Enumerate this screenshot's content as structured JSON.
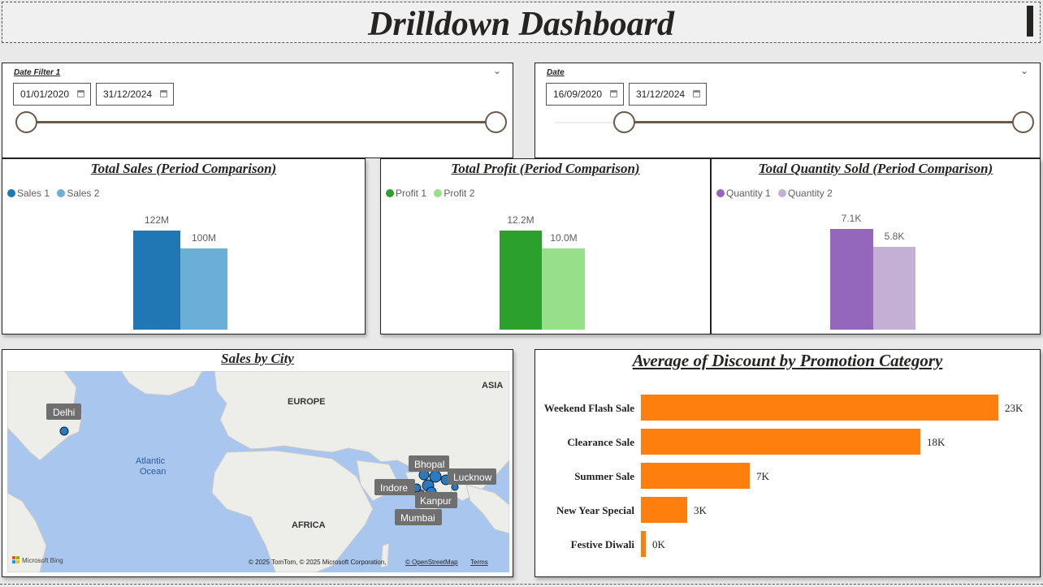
{
  "title": "Drilldown Dashboard",
  "slicer1": {
    "label": "Date Filter 1",
    "start": "01/01/2020",
    "end": "31/12/2024",
    "icon": "chevron-down-icon"
  },
  "slicer2": {
    "label": "Date",
    "start": "16/09/2020",
    "end": "31/12/2024",
    "icon": "chevron-down-icon"
  },
  "sales_chart": {
    "title": "Total Sales (Period Comparison)",
    "legend": [
      "Sales 1",
      "Sales 2"
    ],
    "colors": [
      "#1f77b4",
      "#6baed6"
    ],
    "labels": [
      "122M",
      "100M"
    ]
  },
  "profit_chart": {
    "title": "Total Profit (Period Comparison)",
    "legend": [
      "Profit 1",
      "Profit 2"
    ],
    "colors": [
      "#2ca02c",
      "#98df8a"
    ],
    "labels": [
      "12.2M",
      "10.0M"
    ]
  },
  "quantity_chart": {
    "title": "Total Quantity Sold (Period Comparison)",
    "legend": [
      "Quantity 1",
      "Quantity 2"
    ],
    "colors": [
      "#9467bd",
      "#c5b0d5"
    ],
    "labels": [
      "7.1K",
      "5.8K"
    ]
  },
  "map": {
    "title": "Sales by City",
    "regions": [
      "EUROPE",
      "ASIA",
      "AFRICA"
    ],
    "ocean": [
      "Atlantic",
      "Ocean"
    ],
    "cities": [
      "Delhi",
      "Bhopal",
      "Lucknow",
      "Indore",
      "Kanpur",
      "Mumbai"
    ],
    "attribution": "© 2025 TomTom, © 2025 Microsoft Corporation,",
    "osm": "© OpenStreetMap",
    "terms": "Terms",
    "bing": "Microsoft Bing"
  },
  "discount_chart": {
    "title": "Average of Discount by Promotion Category",
    "color": "#ff7f0e",
    "labels": [
      "23K",
      "18K",
      "7K",
      "3K",
      "0K"
    ]
  },
  "chart_data": [
    {
      "type": "bar",
      "title": "Total Sales (Period Comparison)",
      "series": [
        {
          "name": "Sales 1",
          "values": [
            122
          ]
        },
        {
          "name": "Sales 2",
          "values": [
            100
          ]
        }
      ],
      "unit": "M",
      "ylim": [
        0,
        122
      ]
    },
    {
      "type": "bar",
      "title": "Total Profit (Period Comparison)",
      "series": [
        {
          "name": "Profit 1",
          "values": [
            12.2
          ]
        },
        {
          "name": "Profit 2",
          "values": [
            10.0
          ]
        }
      ],
      "unit": "M",
      "ylim": [
        0,
        12.2
      ]
    },
    {
      "type": "bar",
      "title": "Total Quantity Sold (Period Comparison)",
      "series": [
        {
          "name": "Quantity 1",
          "values": [
            7.1
          ]
        },
        {
          "name": "Quantity 2",
          "values": [
            5.8
          ]
        }
      ],
      "unit": "K",
      "ylim": [
        0,
        7.1
      ]
    },
    {
      "type": "bar",
      "orientation": "horizontal",
      "title": "Average of Discount by Promotion Category",
      "categories": [
        "Weekend Flash Sale",
        "Clearance Sale",
        "Summer Sale",
        "New Year Special",
        "Festive Diwali"
      ],
      "values": [
        23,
        18,
        7,
        3,
        0.3
      ],
      "unit": "K",
      "xlim": [
        0,
        23
      ]
    }
  ]
}
